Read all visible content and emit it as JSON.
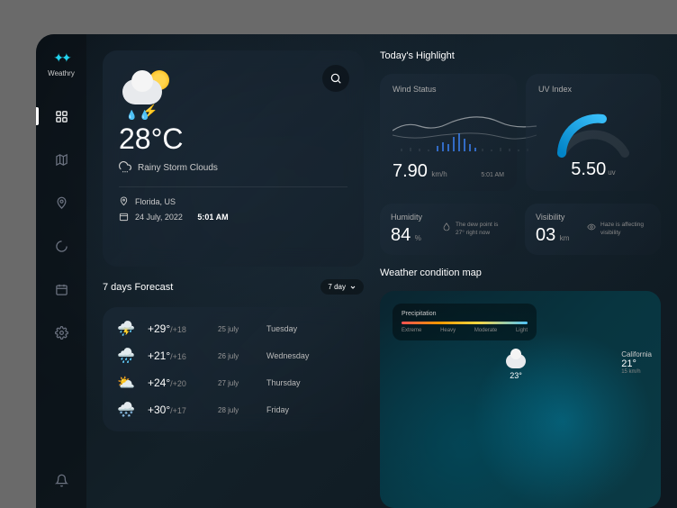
{
  "app": {
    "name": "Weathry"
  },
  "current": {
    "temp": "28°C",
    "condition": "Rainy Storm Clouds",
    "location": "Florida, US",
    "date": "24 July, 2022",
    "time": "5:01 AM"
  },
  "forecast": {
    "title": "7 days Forecast",
    "selector": "7 day",
    "items": [
      {
        "high": "+29°",
        "low": "/+18",
        "date": "25 july",
        "day": "Tuesday"
      },
      {
        "high": "+21°",
        "low": "/+16",
        "date": "26 july",
        "day": "Wednesday"
      },
      {
        "high": "+24°",
        "low": "/+20",
        "date": "27 july",
        "day": "Thursday"
      },
      {
        "high": "+30°",
        "low": "/+17",
        "date": "28 july",
        "day": "Friday"
      }
    ]
  },
  "highlight": {
    "title": "Today's Highlight",
    "wind": {
      "label": "Wind Status",
      "value": "7.90",
      "unit": "km/h",
      "time": "5:01 AM"
    },
    "uv": {
      "label": "UV Index",
      "value": "5.50",
      "unit": "uv"
    },
    "humidity": {
      "label": "Humidity",
      "value": "84",
      "unit": "%",
      "note": "The dew point is 27° right now"
    },
    "visibility": {
      "label": "Visibility",
      "value": "03",
      "unit": "km",
      "note": "Haze is affecting visibility"
    }
  },
  "map": {
    "title": "Weather condition map",
    "legend": {
      "title": "Precipitation",
      "labels": [
        "Extreme",
        "Heavy",
        "Moderate",
        "Light"
      ]
    },
    "markers": {
      "m1_temp": "23°",
      "m2_label": "California",
      "m2_temp": "21°",
      "m2_sub": "15 km/h"
    }
  },
  "chart_data": {
    "type": "line",
    "title": "Wind Status",
    "ylabel": "km/h",
    "x": [
      "00",
      "01",
      "02",
      "03",
      "04",
      "05",
      "06",
      "07",
      "08",
      "09",
      "10",
      "11",
      "12",
      "13",
      "14",
      "15"
    ],
    "values": [
      5.2,
      5.8,
      6.0,
      5.6,
      5.9,
      6.4,
      7.0,
      7.4,
      7.9,
      7.6,
      7.2,
      6.8,
      6.5,
      6.9,
      7.1,
      6.6
    ],
    "ylim": [
      4,
      9
    ]
  }
}
